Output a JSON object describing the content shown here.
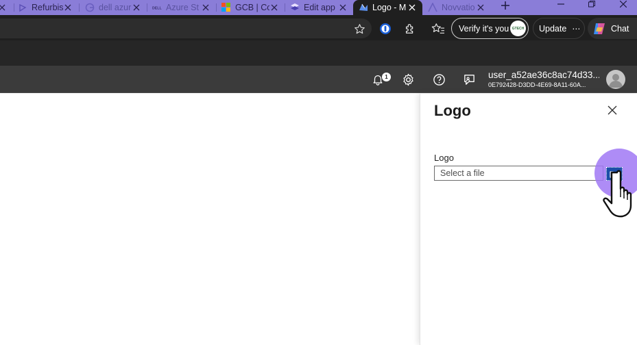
{
  "browser": {
    "tabs": [
      {
        "title": "Refurbis",
        "icon": "refurbish-favicon"
      },
      {
        "title": "dell azur",
        "icon": "google-favicon"
      },
      {
        "title": "Azure St",
        "icon": "dell-favicon"
      },
      {
        "title": "GCB | Co",
        "icon": "microsoft-favicon"
      },
      {
        "title": "Edit app",
        "icon": "power-apps-favicon"
      },
      {
        "title": "Logo - M",
        "icon": "entra-favicon",
        "active": true
      },
      {
        "title": "Novvatio",
        "icon": "novvation-favicon"
      }
    ],
    "toolbar": {
      "verify_label": "Verify it's you",
      "verify_badge": "GTECH",
      "update_label": "Update",
      "update_more": "⋯",
      "chat_label": "Chat"
    }
  },
  "portal": {
    "notifications_count": "1",
    "account": {
      "username": "user_a52ae36c8ac74d33...",
      "tenant": "0E792428-D3DD-4E69-8A11-60A..."
    }
  },
  "panel": {
    "title": "Logo",
    "field_label": "Logo",
    "file_placeholder": "Select a file"
  },
  "colors": {
    "tab_strip": "#8a7dd8",
    "browser_dark": "#1f1f1f",
    "portal_header": "#3b3b3b",
    "browse_button": "#1c4fa8",
    "click_highlight": "#a078f5"
  }
}
